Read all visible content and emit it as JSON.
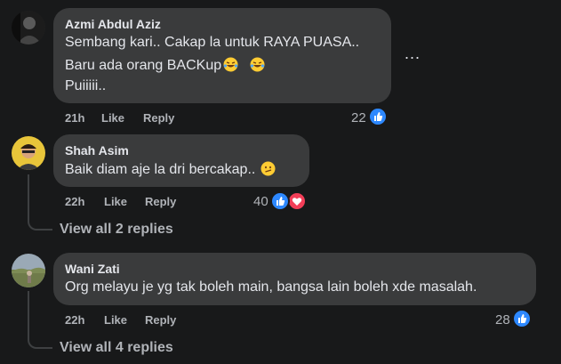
{
  "comments": [
    {
      "author": "Azmi Abdul Aziz",
      "lines": [
        "Sembang kari.. Cakap la untuk RAYA PUASA..",
        "Baru ada orang BACKup",
        "Puiiiii.."
      ],
      "emoji": [
        "rolling-laughing-emoji",
        "rolling-laughing-emoji"
      ],
      "time": "21h",
      "like_label": "Like",
      "reply_label": "Reply",
      "reaction_count": "22",
      "reactions": [
        "like"
      ]
    },
    {
      "author": "Shah Asim",
      "lines": [
        "Baik diam aje la dri bercakap.."
      ],
      "emoji": [
        "smirk-emoji"
      ],
      "time": "22h",
      "like_label": "Like",
      "reply_label": "Reply",
      "reaction_count": "40",
      "reactions": [
        "like",
        "love"
      ],
      "view_replies": "View all 2 replies"
    },
    {
      "author": "Wani Zati",
      "lines": [
        "Org melayu je yg tak boleh main, bangsa lain boleh xde masalah."
      ],
      "time": "22h",
      "like_label": "Like",
      "reply_label": "Reply",
      "reaction_count": "28",
      "reactions": [
        "like"
      ],
      "view_replies": "View all 4 replies"
    }
  ],
  "more_options": "...",
  "colors": {
    "background": "#18191a",
    "bubble": "#3a3b3c",
    "text": "#e4e6eb",
    "muted": "#b0b3b8",
    "like_blue": "#2d88ff",
    "love_red": "#f33e58"
  }
}
